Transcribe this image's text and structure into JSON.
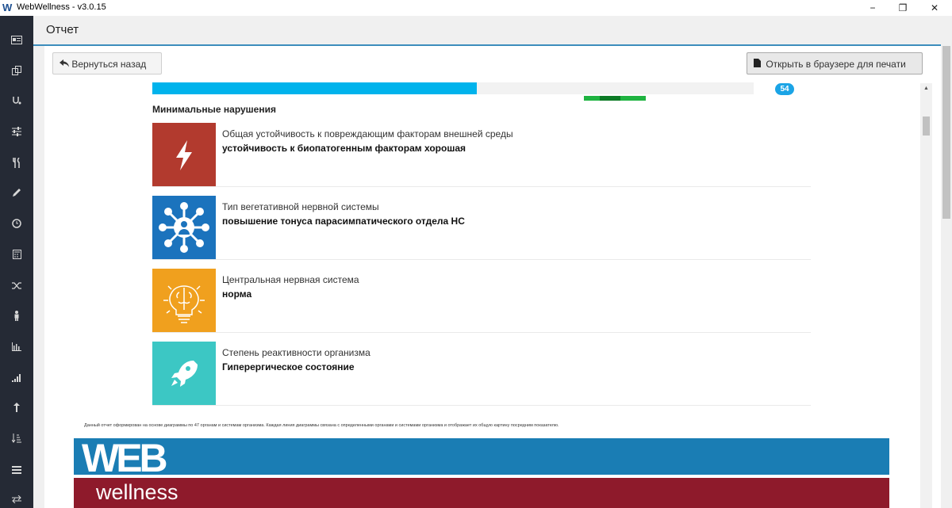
{
  "window": {
    "title": "WebWellness - v3.0.15",
    "logo_letter": "W",
    "minimize": "−",
    "restore": "❐",
    "close": "✕"
  },
  "sidebar": {
    "icons": [
      "id-card-icon",
      "copy-icon",
      "stethoscope-icon",
      "sliders-icon",
      "cutlery-icon",
      "pencil-icon",
      "clock-icon",
      "calculator-icon",
      "shuffle-icon",
      "person-icon",
      "bar-chart-icon",
      "signal-icon",
      "arrow-up-icon",
      "sort-icon",
      "list-icon",
      "exchange-icon"
    ]
  },
  "header": {
    "title": "Отчет"
  },
  "toolbar": {
    "back_label": "Вернуться назад",
    "print_label": "Открыть в браузере для печати"
  },
  "report": {
    "progress_fraction": 0.54,
    "badge": "54",
    "section_title": "Минимальные нарушения",
    "items": [
      {
        "title": "Общая устойчивость к повреждающим факторам внешней среды",
        "value": "устойчивость к биопатогенным факторам хорошая",
        "color": "#b23a2e",
        "icon": "lightning-icon"
      },
      {
        "title": "Тип вегетативной нервной системы",
        "value": "повышение тонуса парасимпатического отдела НС",
        "color": "#1b73bd",
        "icon": "network-person-icon"
      },
      {
        "title": "Центральная нервная система",
        "value": "норма",
        "color": "#f0a01e",
        "icon": "brain-bulb-icon"
      },
      {
        "title": "Степень реактивности организма",
        "value": "Гиперергическое состояние",
        "color": "#3cc7c4",
        "icon": "rocket-icon"
      }
    ],
    "footnote": "Данный отчет оформирован на основе диаграммы по 47 органам и системам организма. Каждая линия диаграммы связана с определенными органами и системами организма и отображает их общую картину посредним показателю.",
    "banner": {
      "word": "WEB",
      "sub": "wellness"
    }
  }
}
